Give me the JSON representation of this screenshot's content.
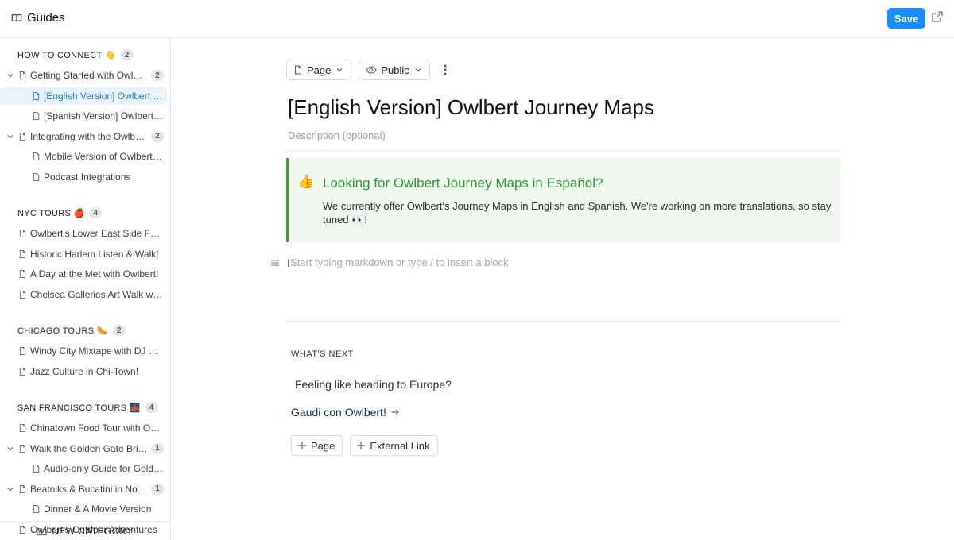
{
  "app": {
    "title": "Guides"
  },
  "toolbar": {
    "save_label": "Save"
  },
  "sidebar": {
    "categories": [
      {
        "title": "HOW TO CONNECT 👋",
        "count": "2",
        "items": [
          {
            "label": "Getting Started with Owlbert",
            "count": "2",
            "expanded": true
          },
          {
            "label": "[English Version] Owlbert Journey Maps",
            "child": true,
            "active": true
          },
          {
            "label": "[Spanish Version] Owlbert Journey Maps",
            "child": true
          },
          {
            "label": "Integrating with the Owlbert App",
            "count": "2",
            "expanded": true
          },
          {
            "label": "Mobile Version of Owlbert Guides",
            "child": true
          },
          {
            "label": "Podcast Integrations",
            "child": true
          }
        ]
      },
      {
        "title": "NYC TOURS 🍎",
        "count": "4",
        "items": [
          {
            "label": "Owlbert's Lower East Side Food Tour"
          },
          {
            "label": "Historic Harlem Listen & Walk!"
          },
          {
            "label": "A Day at the Met with Owlbert!"
          },
          {
            "label": "Chelsea Galleries Art Walk with Owlbert"
          }
        ]
      },
      {
        "title": "CHICAGO TOURS 🌭",
        "count": "2",
        "items": [
          {
            "label": "Windy City Mixtape with DJ Owlbert"
          },
          {
            "label": "Jazz Culture in Chi-Town!"
          }
        ]
      },
      {
        "title": "SAN FRANCISCO TOURS 🌉",
        "count": "4",
        "items": [
          {
            "label": "Chinatown Food Tour with Owlbert"
          },
          {
            "label": "Walk the Golden Gate Bridge",
            "count": "1",
            "expanded": true
          },
          {
            "label": "Audio-only Guide for Golden Gate",
            "child": true
          },
          {
            "label": "Beatniks & Bucatini in North Beach",
            "count": "1",
            "expanded": true
          },
          {
            "label": "Dinner & A Movie Version",
            "child": true
          },
          {
            "label": "Owlbert's Outdoor Adventures"
          }
        ]
      }
    ],
    "new_category_label": "NEW CATEGORY"
  },
  "editor": {
    "page_type_label": "Page",
    "visibility_label": "Public",
    "title": "[English Version] Owlbert Journey Maps",
    "description_placeholder": "Description (optional)",
    "callout": {
      "emoji": "👍",
      "title": "Looking for Owlbert Journey Maps in Español?",
      "body": "We currently offer Owlbert's Journey Maps in English and Spanish. We're working on more translations, so stay tuned 👀!"
    },
    "block_placeholder": "Start typing markdown or type / to insert a block",
    "whats_next": {
      "header": "WHAT'S NEXT",
      "question": "Feeling like heading to Europe?",
      "link_label": "Gaudi con Owlbert!",
      "add_page_label": "Page",
      "add_external_label": "External Link"
    }
  },
  "colors": {
    "accent": "#1a8cff",
    "callout_green": "#2f9a34",
    "callout_bg": "#eff7ee",
    "active_item": "#1a7de0"
  }
}
